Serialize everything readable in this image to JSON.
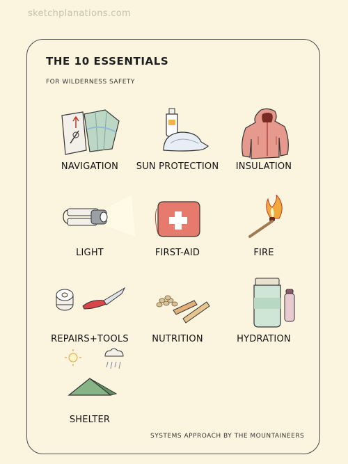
{
  "watermark": "sketchplanations.com",
  "title": "THE 10 ESSENTIALS",
  "subtitle": "FOR WILDERNESS SAFETY",
  "essentials": [
    {
      "label": "NAVIGATION",
      "icon": "map-compass-icon"
    },
    {
      "label": "SUN PROTECTION",
      "icon": "sunscreen-cap-icon"
    },
    {
      "label": "INSULATION",
      "icon": "jacket-icon"
    },
    {
      "label": "LIGHT",
      "icon": "headlamp-icon"
    },
    {
      "label": "FIRST-AID",
      "icon": "first-aid-kit-icon"
    },
    {
      "label": "FIRE",
      "icon": "match-flame-icon"
    },
    {
      "label": "REPAIRS+TOOLS",
      "icon": "tape-knife-icon"
    },
    {
      "label": "NUTRITION",
      "icon": "nuts-bars-icon"
    },
    {
      "label": "HYDRATION",
      "icon": "water-bottle-icon"
    },
    {
      "label": "SHELTER",
      "icon": "tent-sun-rain-icon"
    }
  ],
  "footer": "SYSTEMS APPROACH by THE MOUNTAINEERS"
}
